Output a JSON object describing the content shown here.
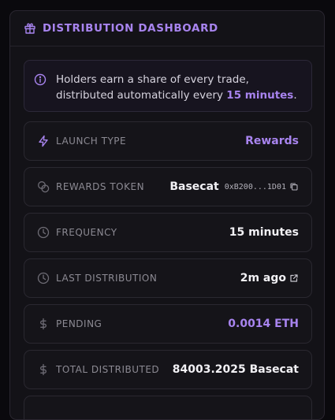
{
  "header": {
    "title": "DISTRIBUTION DASHBOARD",
    "icon": "gift-icon"
  },
  "notice": {
    "icon": "info-icon",
    "text_before": "Holders earn a share of every trade, distributed automatically every ",
    "highlight": "15 minutes",
    "text_after": "."
  },
  "rows": [
    {
      "icon": "bolt-icon",
      "label": "LAUNCH TYPE",
      "value": "Rewards"
    },
    {
      "icon": "coins-icon",
      "label": "REWARDS TOKEN",
      "value": "Basecat",
      "address": "0xB200...1D01",
      "action_icon": "copy-icon"
    },
    {
      "icon": "clock-icon",
      "label": "FREQUENCY",
      "value": "15 minutes"
    },
    {
      "icon": "clock-icon",
      "label": "LAST DISTRIBUTION",
      "value": "2m ago",
      "action_icon": "external-link-icon"
    },
    {
      "icon": "dollar-icon",
      "label": "PENDING",
      "value": "0.0014 ETH"
    },
    {
      "icon": "dollar-icon",
      "label": "TOTAL DISTRIBUTED",
      "value": "84003.2025 Basecat"
    }
  ],
  "colors": {
    "accent": "#a884ef",
    "background": "#0a090d",
    "panel": "#131217"
  }
}
